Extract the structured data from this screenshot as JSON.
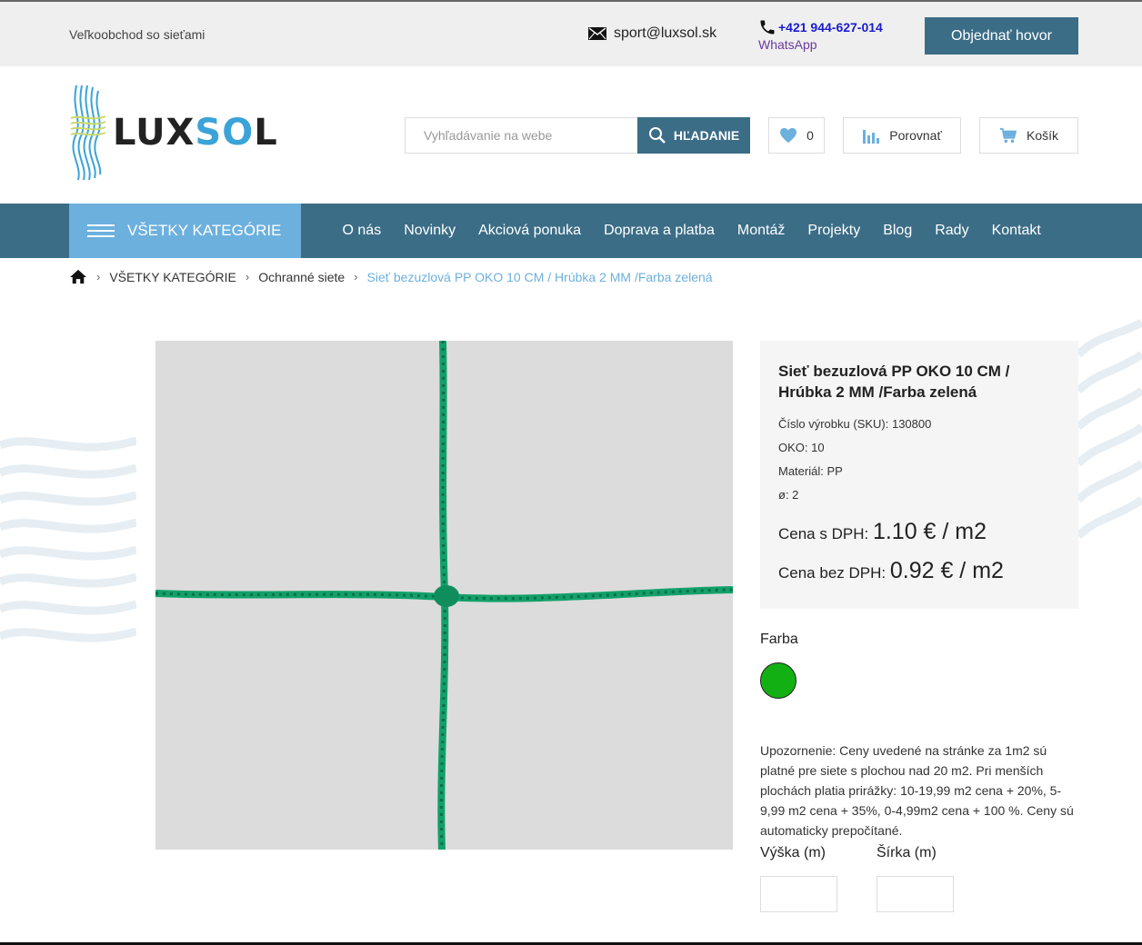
{
  "topbar": {
    "tagline": "Veľkoobchod so sieťami",
    "email": "sport@luxsol.sk",
    "phone": "+421 944-627-014",
    "whatsapp": "WhatsApp",
    "call_button": "Objednať hovor"
  },
  "header": {
    "logo_text_a": "LUX",
    "logo_text_b": "SO",
    "logo_text_c": "L",
    "search_placeholder": "Vyhľadávanie na webe",
    "search_button": "HĽADANIE",
    "wishlist_count": "0",
    "compare_label": "Porovnať",
    "cart_label": "Košík"
  },
  "nav": {
    "all_categories": "VŠETKY KATEGÓRIE",
    "items": [
      "O nás",
      "Novinky",
      "Akciová ponuka",
      "Doprava a platba",
      "Montáž",
      "Projekty",
      "Blog",
      "Rady",
      "Kontakt"
    ]
  },
  "breadcrumb": {
    "items": [
      "VŠETKY KATEGÓRIE",
      "Ochranné siete"
    ],
    "current": "Sieť bezuzlová PP OKO 10 CM / Hrúbka 2 MM /Farba zelená"
  },
  "product": {
    "title": "Sieť bezuzlová PP OKO 10 CM / Hrúbka 2 MM /Farba zelená",
    "sku": "Číslo výrobku (SKU): 130800",
    "oko": "OKO: 10",
    "material": "Materiál: PP",
    "diameter": "ø: 2",
    "price_vat_label": "Cena s DPH:",
    "price_vat_value": "1.10 € / m2",
    "price_novat_label": "Cena bez DPH:",
    "price_novat_value": "0.92 € / m2",
    "color_label": "Farba",
    "color_swatch": "#13b013",
    "notice": "Upozornenie: Ceny uvedené na stránke za 1m2 sú platné pre siete s plochou nad 20 m2. Pri menších plochách platia prirážky: 10-19,99 m2 cena + 20%, 5-9,99 m2 cena + 35%, 0-4,99m2 cena + 100 %. Ceny sú automaticky prepočítané.",
    "height_label": "Výška (m)",
    "width_label": "Šírka (m)",
    "height_value": "",
    "width_value": ""
  },
  "colors": {
    "primary": "#3b6d86",
    "accent": "#6cb0de",
    "net_green": "#12a06a"
  }
}
